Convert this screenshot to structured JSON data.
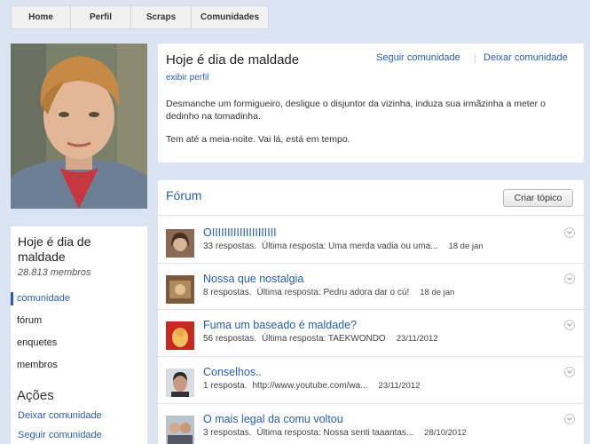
{
  "nav": {
    "home": "Home",
    "perfil": "Perfil",
    "scraps": "Scraps",
    "comunidades": "Comunidades"
  },
  "community": {
    "name": "Hoje é dia de maldade",
    "members": "28.813 membros",
    "follow": "Seguir comunidade",
    "leave": "Deixar comunidade",
    "view_profile": "exibir perfil",
    "description_1": "Desmanche um formigueiro, desligue o disjuntor da vizinha, induza sua irmãzinha a meter o dedinho na tomadinha.",
    "description_2": "Tem até a meia-noite. Vai lá, está em tempo."
  },
  "sidebar": {
    "items": [
      {
        "label": "comunidade"
      },
      {
        "label": "fórum"
      },
      {
        "label": "enquetes"
      },
      {
        "label": "membros"
      }
    ],
    "acoes_title": "Ações",
    "acoes": [
      {
        "label": "Deixar comunidade"
      },
      {
        "label": "Seguir comunidade"
      }
    ]
  },
  "forum": {
    "title": "Fórum",
    "create_button": "Criar tópico",
    "topics": [
      {
        "title": "OIIIIIIIIIIIIIIIIIIIII",
        "responses": "33 respostas.",
        "last": "Última resposta: Uma merda vadia ou uma...",
        "date": "18 de jan"
      },
      {
        "title": "Nossa que nostalgia",
        "responses": "8 respostas.",
        "last": "Última resposta: Pedru adora dar o cú!",
        "date": "18 de jan"
      },
      {
        "title": "Fuma um baseado é maldade?",
        "responses": "56 respostas.",
        "last": "Última resposta: TAEKWONDO",
        "date": "23/11/2012"
      },
      {
        "title": "Conselhos..",
        "responses": "1 resposta.",
        "last": "http://www.youtube.com/wa...",
        "date": "23/11/2012"
      },
      {
        "title": "O mais legal da comu voltou",
        "responses": "3 respostas.",
        "last": "Última resposta: Nossa senti taaantas...",
        "date": "28/10/2012"
      }
    ]
  },
  "colors": {
    "background": "#dbe4f3",
    "link": "#2a5db0",
    "card": "#ffffff"
  }
}
